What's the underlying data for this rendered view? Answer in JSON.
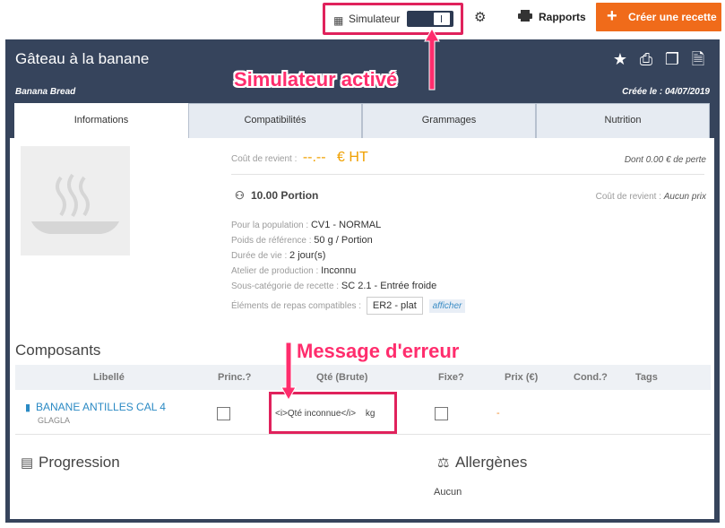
{
  "topbar": {
    "simulator_label": "Simulateur",
    "rapports_label": "Rapports",
    "create_label": "Créer une recette"
  },
  "recipe": {
    "title": "Gâteau à la banane",
    "subtitle": "Banana Bread",
    "created": "Créée le : 04/07/2019"
  },
  "tabs": [
    {
      "label": "Informations"
    },
    {
      "label": "Compatibilités"
    },
    {
      "label": "Grammages"
    },
    {
      "label": "Nutrition"
    }
  ],
  "info": {
    "cost_label": "Coût de revient :",
    "cost_value": "--.--",
    "cost_unit": "€ HT",
    "perte": "Dont 0.00 € de perte",
    "portion": "10.00 Portion",
    "cost2_label": "Coût de revient :",
    "cost2_value": "Aucun prix",
    "population_label": "Pour la population :",
    "population_value": "CV1 - NORMAL",
    "poids_label": "Poids de référence :",
    "poids_value": "50 g / Portion",
    "duree_label": "Durée de vie :",
    "duree_value": "2 jour(s)",
    "atelier_label": "Atelier de production :",
    "atelier_value": "Inconnu",
    "souscat_label": "Sous-catégorie de recette :",
    "souscat_value": "SC 2.1 - Entrée froide",
    "elements_label": "Éléments de repas compatibles :",
    "elements_value": "ER2 - plat",
    "afficher": "afficher"
  },
  "composants": {
    "title": "Composants",
    "headers": [
      "Libellé",
      "Princ.?",
      "Qté (Brute)",
      "Fixe?",
      "Prix (€)",
      "Cond.?",
      "Tags"
    ],
    "rows": [
      {
        "name": "BANANE ANTILLES CAL 4",
        "sub": "GLAGLA",
        "qty": "<i>Qté inconnue</i>",
        "unit": "kg",
        "price": "-"
      }
    ]
  },
  "progression": {
    "title": "Progression"
  },
  "allergenes": {
    "title": "Allergènes",
    "value": "Aucun"
  },
  "annotations": {
    "sim": "Simulateur activé",
    "err": "Message d'erreur"
  },
  "colors": {
    "accent": "#f06b1a",
    "header": "#36445c",
    "annotation": "#e0225c",
    "link": "#2b8ac4"
  }
}
